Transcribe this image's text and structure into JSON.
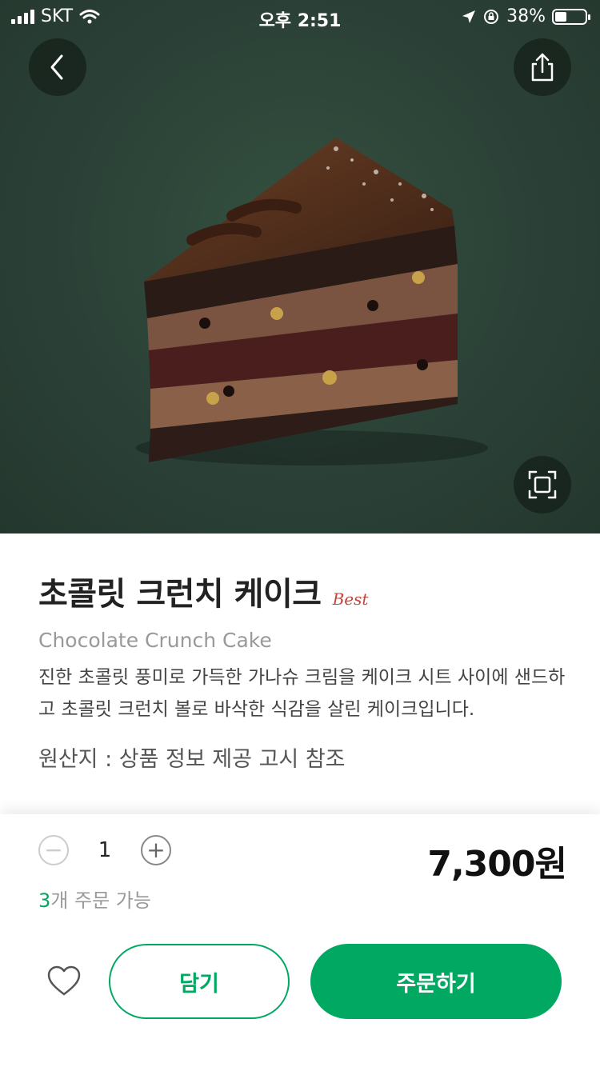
{
  "status_bar": {
    "carrier": "SKT",
    "time": "오후 2:51",
    "battery_percent": "38%",
    "battery_level": 0.38
  },
  "hero": {
    "back_icon": "chevron-left-icon",
    "share_icon": "share-icon",
    "zoom_icon": "fullscreen-icon",
    "image": "chocolate-crunch-cake-slice"
  },
  "product": {
    "name": "초콜릿 크런치 케이크",
    "badge": "Best",
    "name_en": "Chocolate Crunch Cake",
    "description": "진한 초콜릿 풍미로 가득한 가나슈 크림을 케이크 시트 사이에 샌드하고 초콜릿 크런치 볼로 바삭한 식감을 살린 케이크입니다.",
    "origin": "원산지 : 상품 정보 제공 고시 참조"
  },
  "order": {
    "minus": "−",
    "plus": "+",
    "quantity": "1",
    "price": "7,300원",
    "available_count": "3",
    "available_text": "개 주문 가능",
    "favorite_icon": "heart-outline-icon",
    "cart_label": "담기",
    "order_label": "주문하기"
  },
  "colors": {
    "accent": "#00a862",
    "hero_bg": "#2b4137",
    "badge": "#c0463b"
  }
}
